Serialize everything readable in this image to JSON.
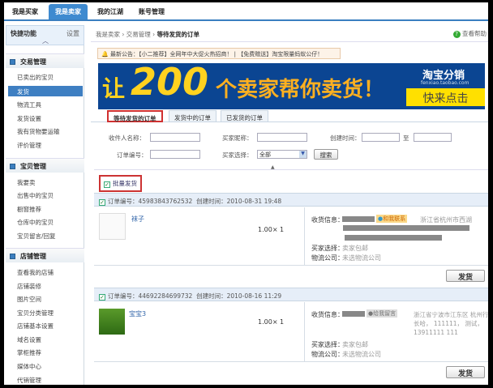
{
  "nav": {
    "tabs": [
      "我是买家",
      "我是卖家",
      "我的江湖",
      "账号管理"
    ]
  },
  "sidebar": {
    "quick": "快捷功能",
    "settings": "设置",
    "sections": [
      {
        "title": "交易管理",
        "items": [
          "已卖出的宝贝",
          "发货",
          "物流工具",
          "发货设置",
          "我有货物要运输",
          "评价管理"
        ]
      },
      {
        "title": "宝贝管理",
        "items": [
          "我要卖",
          "出售中的宝贝",
          "橱窗推荐",
          "仓库中的宝贝",
          "宝贝留言/回复"
        ]
      },
      {
        "title": "店铺管理",
        "items": [
          "查看我的店铺",
          "店铺装修",
          "图片空间",
          "宝贝分类管理",
          "店铺基本设置",
          "域名设置",
          "掌柜推荐",
          "媒体中心",
          "代销管理"
        ]
      }
    ]
  },
  "breadcrumb": [
    "我是卖家",
    "交易管理",
    "等待发货的订单"
  ],
  "help": "查看帮助",
  "notice": "最新公告：【小二推荐】全网年中大促火热招商！ | 【免费赠送】淘宝限量蚂蚁公仔！",
  "banner": {
    "pre": "让",
    "num": "200",
    "post": "个卖家帮你卖货！",
    "brand": "淘宝分销",
    "url": "fenxiao.taobao.com",
    "cta": "快来点击"
  },
  "tabs": [
    "等待发货的订单",
    "发货中的订单",
    "已发货的订单"
  ],
  "form": {
    "receiver": "收件人名称：",
    "buyer_nick": "买家昵称：",
    "created": "创建时间：",
    "to": "至",
    "order_no": "订单编号：",
    "buyer_choice": "买家选择：",
    "select_value": "全部",
    "search": "搜索"
  },
  "batch": "批量发货",
  "orders": [
    {
      "no_label": "订单编号：",
      "no": "45983843762532",
      "time_label": "创建时间：",
      "time": "2010-08-31 19:48",
      "item": "袜子",
      "price": "1.00× 1",
      "recv_label": "收货信息：",
      "contact": "和我联系",
      "addr": "浙江省杭州市西湖",
      "choice_label": "买家选择：",
      "choice": "卖家包邮",
      "logi_label": "物流公司：",
      "logi": "未选物流公司",
      "ship": "发货"
    },
    {
      "no_label": "订单编号：",
      "no": "44692284699732",
      "time_label": "创建时间：",
      "time": "2010-08-16 11:29",
      "item": "宝宝3",
      "price": "1.00× 1",
      "recv_label": "收货信息：",
      "contact": "给我留言",
      "addr": "浙江省宁波市江东区 杭州行长哈， 111111， 测试， 13911111 111",
      "choice_label": "买家选择：",
      "choice": "卖家包邮",
      "logi_label": "物流公司：",
      "logi": "未选物流公司",
      "ship": "发货"
    }
  ]
}
